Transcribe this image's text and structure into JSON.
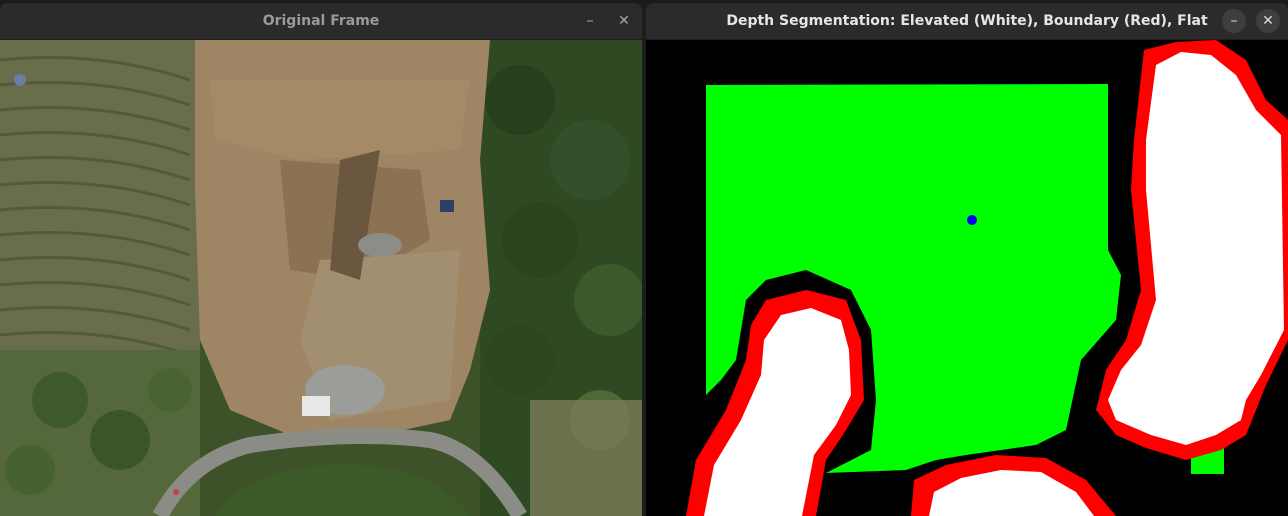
{
  "windows": {
    "original": {
      "title": "Original Frame",
      "minimize_icon": "minimize-icon",
      "close_icon": "close-icon"
    },
    "segmentation": {
      "title": "Depth Segmentation: Elevated (White), Boundary (Red), Flat (Green)",
      "minimize_icon": "minimize-icon",
      "close_icon": "close-icon"
    }
  },
  "colors": {
    "elevated": "#ffffff",
    "boundary": "#ff0000",
    "flat": "#00ff00",
    "background": "#000000",
    "center_marker": "#0000ff"
  }
}
